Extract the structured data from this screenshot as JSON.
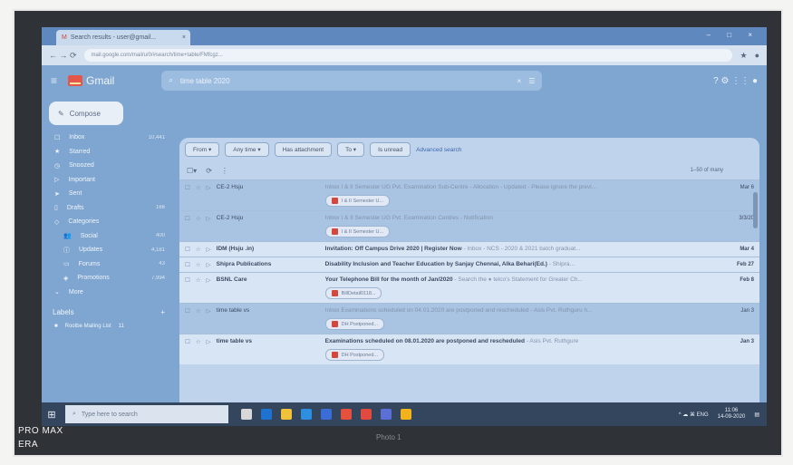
{
  "browser": {
    "tab_title": "Search results - user@gmail...",
    "tab_close": "×",
    "window_controls": "– □ ×",
    "url": "mail.google.com/mail/u/0/#search/time+table/FMfcgz...",
    "nav_buttons": "← → ⟳"
  },
  "gmail": {
    "logo_text": "Gmail",
    "search_query": "time table 2020",
    "search_icon": "⌕",
    "clear_icon": "×",
    "filter_icon": "☰",
    "header_icons": "? ⚙ ⋮⋮ ●",
    "compose": "Compose",
    "nav": [
      {
        "icon": "☐",
        "label": "Inbox",
        "count": "10,441"
      },
      {
        "icon": "★",
        "label": "Starred",
        "count": ""
      },
      {
        "icon": "◷",
        "label": "Snoozed",
        "count": ""
      },
      {
        "icon": "▷",
        "label": "Important",
        "count": ""
      },
      {
        "icon": "➤",
        "label": "Sent",
        "count": ""
      },
      {
        "icon": "▯",
        "label": "Drafts",
        "count": "166"
      },
      {
        "icon": "◇",
        "label": "Categories",
        "count": ""
      },
      {
        "icon": "👥",
        "label": "Social",
        "count": "400",
        "sub": true
      },
      {
        "icon": "ⓘ",
        "label": "Updates",
        "count": "4,181",
        "sub": true
      },
      {
        "icon": "▭",
        "label": "Forums",
        "count": "43",
        "sub": true
      },
      {
        "icon": "◈",
        "label": "Promotions",
        "count": "7,994",
        "sub": true
      },
      {
        "icon": "⌄",
        "label": "More",
        "count": ""
      }
    ],
    "labels_header": "Labels",
    "labels_add": "+",
    "label_item": "Rootbe Mailing List",
    "label_count": "11",
    "filters": [
      "From ▾",
      "Any time ▾",
      "Has attachment",
      "To ▾",
      "Is unread"
    ],
    "advanced_search": "Advanced search",
    "toolbar": {
      "select": "☐▾",
      "refresh": "⟳",
      "more": "⋮",
      "pagination": "1–50 of many"
    },
    "emails": [
      {
        "sender": "CE-2 Hsju",
        "subject": "",
        "snippet": "Inbox  I & II Semester UG Pvt. Examination Sub-Centre - Allocation - Updated - Please ignore the previ...",
        "attachment": "I & II Semester U...",
        "date": "Mar 6",
        "unread": false
      },
      {
        "sender": "CE-2 Hsju",
        "subject": "",
        "snippet": "Inbox  I & II Semester UG Pvt. Examination Centres - Notification",
        "attachment": "I & II Semester U...",
        "date": "3/3/20",
        "unread": false
      },
      {
        "sender": "IDM (Hsju .in)",
        "subject": "Invitation: Off Campus Drive 2020 | Register Now",
        "snippet": " - Inbox - NCS - 2020 & 2021 batch graduat...",
        "attachment": "",
        "date": "Mar 4",
        "unread": true
      },
      {
        "sender": "Shipra Publications",
        "subject": "Disability Inclusion and Teacher Education by Sanjay Chennai, Alka Behari(Ed.)",
        "snippet": " - Shipra...",
        "attachment": "",
        "date": "Feb 27",
        "unread": true
      },
      {
        "sender": "BSNL Care",
        "subject": "Your Telephone Bill for the month of Jan/2020",
        "snippet": " - Search the ● telco's Statement for Greater Ch...",
        "attachment": "BillDetail0118...",
        "date": "Feb 8",
        "unread": true
      },
      {
        "sender": "time table vs",
        "subject": "",
        "snippet": "Inbox  Examinations scheduled on 04.01.2020 are postponed and rescheduled - Asis Pvt. Ruthguru h...",
        "attachment": "DH Postponed...",
        "date": "Jan 3",
        "unread": false
      },
      {
        "sender": "time table vs",
        "subject": "Examinations scheduled on 08.01.2020 are postponed and rescheduled",
        "snippet": " - Asis Pvt. Ruthgure",
        "attachment": "DH Postponed...",
        "date": "Jan 3",
        "unread": true
      }
    ]
  },
  "taskbar": {
    "start_icon": "⊞",
    "search_placeholder": "Type here to search",
    "app_colors": [
      "#d8d8d8",
      "#1f73d0",
      "#f0c23a",
      "#2e8fe0",
      "#3a6ed6",
      "#e5513c",
      "#e34a3f",
      "#5b6fd6",
      "#f2b21b"
    ],
    "tray_icons": "^ ☁ ⌘ ENG",
    "time": "11:06",
    "date": "14-09-2020"
  },
  "photo": {
    "camera_text_1": "PRO MAX",
    "camera_text_2": "ERA",
    "bottom_text": "Photo 1"
  }
}
